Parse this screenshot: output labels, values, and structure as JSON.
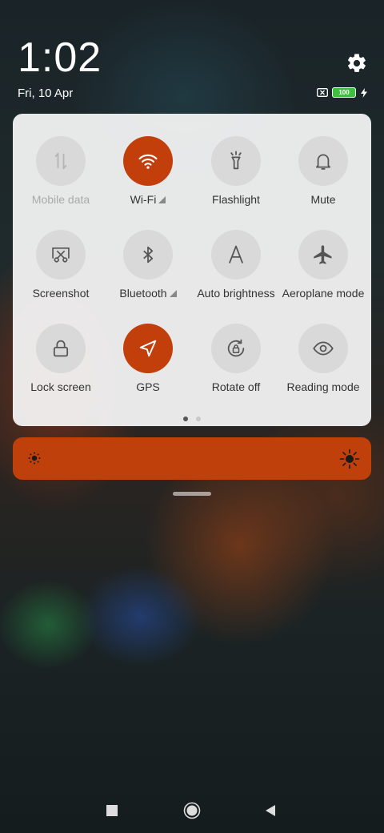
{
  "status": {
    "time": "1:02",
    "date": "Fri, 10 Apr",
    "battery_level": "100"
  },
  "accent_color": "#c23f0c",
  "tiles": [
    {
      "label": "Mobile data",
      "icon": "mobile-data-icon",
      "active": false,
      "disabled": true
    },
    {
      "label": "Wi-Fi",
      "icon": "wifi-icon",
      "active": true
    },
    {
      "label": "Flashlight",
      "icon": "flashlight-icon",
      "active": false
    },
    {
      "label": "Mute",
      "icon": "bell-icon",
      "active": false
    },
    {
      "label": "Screenshot",
      "icon": "screenshot-icon",
      "active": false
    },
    {
      "label": "Bluetooth",
      "icon": "bluetooth-icon",
      "active": false
    },
    {
      "label": "Auto brightness",
      "icon": "auto-brightness-icon",
      "active": false
    },
    {
      "label": "Aeroplane mode",
      "icon": "airplane-icon",
      "active": false
    },
    {
      "label": "Lock screen",
      "icon": "lock-icon",
      "active": false
    },
    {
      "label": "GPS",
      "icon": "location-arrow-icon",
      "active": true
    },
    {
      "label": "Rotate off",
      "icon": "rotate-lock-icon",
      "active": false
    },
    {
      "label": "Reading mode",
      "icon": "eye-icon",
      "active": false
    }
  ],
  "page_indicator": {
    "pages": 2,
    "current": 1
  },
  "brightness": {
    "level_fraction": 1.0
  },
  "nav": {
    "buttons": [
      "recents-icon",
      "home-icon",
      "back-icon"
    ]
  }
}
